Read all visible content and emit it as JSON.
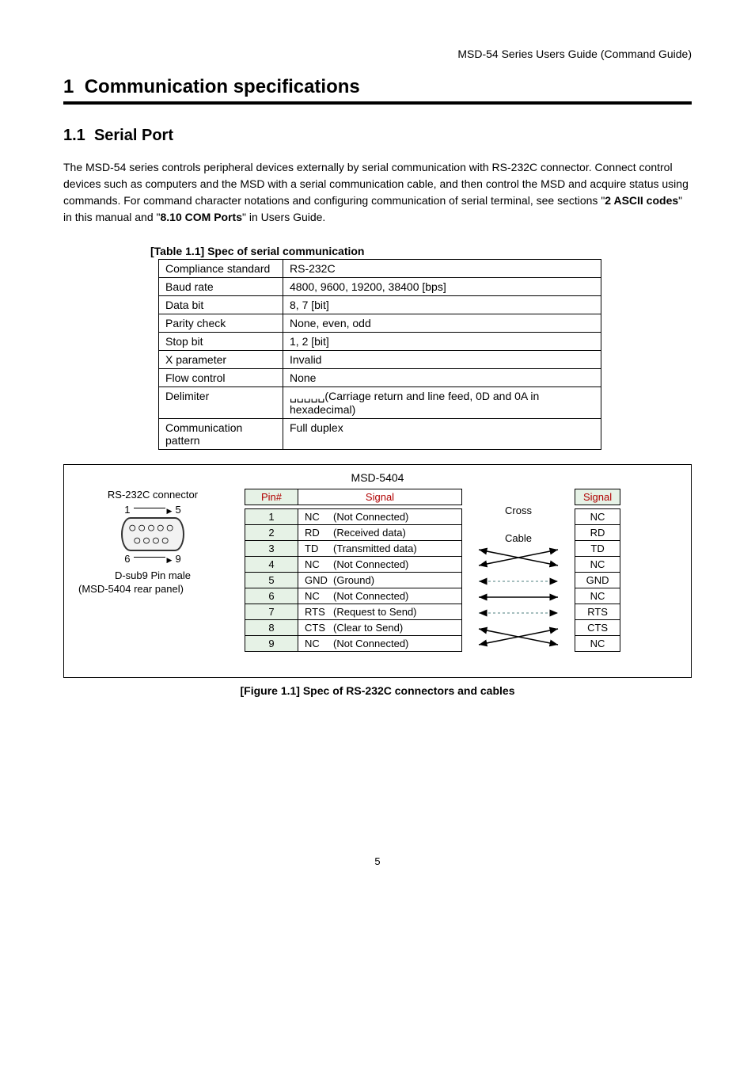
{
  "header": "MSD-54 Series Users Guide (Command Guide)",
  "h1_num": "1",
  "h1_title": "Communication specifications",
  "h2_num": "1.1",
  "h2_title": "Serial Port",
  "body_p1": "The MSD-54 series controls peripheral devices externally by serial communication with RS-232C connector. Connect control devices such as computers and the MSD with a serial communication cable, and then control the MSD and acquire status using commands. For command character notations and configuring communication of serial terminal, see sections \"",
  "body_b1": "2 ASCII codes",
  "body_p2": "\" in this manual and \"",
  "body_b2": "8.10 COM Ports",
  "body_p3": "\" in Users Guide.",
  "table_caption": "[Table 1.1] Spec of serial communication",
  "spec_rows": [
    {
      "k": "Compliance standard",
      "v": "RS-232C"
    },
    {
      "k": "Baud rate",
      "v": "4800, 9600, 19200, 38400 [bps]"
    },
    {
      "k": "Data bit",
      "v": "8, 7 [bit]"
    },
    {
      "k": "Parity check",
      "v": "None, even, odd"
    },
    {
      "k": "Stop bit",
      "v": "1, 2 [bit]"
    },
    {
      "k": "X parameter",
      "v": "Invalid"
    },
    {
      "k": "Flow control",
      "v": "None"
    },
    {
      "k": "Delimiter",
      "v": "␣␣␣␣␣(Carriage return and line feed, 0D and 0A in hexadecimal)"
    },
    {
      "k": "Communication pattern",
      "v": "Full duplex"
    }
  ],
  "figure_title": "MSD-5404",
  "left": {
    "connector_label": "RS-232C connector",
    "pin_top_from": "1",
    "pin_top_to": "5",
    "pin_bot_from": "6",
    "pin_bot_to": "9",
    "sub9": "D-sub9 Pin male",
    "rear_panel": "(MSD-5404 rear panel)"
  },
  "pin_header_pin": "Pin#",
  "pin_header_signal": "Signal",
  "pins": [
    {
      "n": "1",
      "abbr": "NC",
      "desc": "(Not Connected)"
    },
    {
      "n": "2",
      "abbr": "RD",
      "desc": "(Received data)"
    },
    {
      "n": "3",
      "abbr": "TD",
      "desc": "(Transmitted data)"
    },
    {
      "n": "4",
      "abbr": "NC",
      "desc": "(Not Connected)"
    },
    {
      "n": "5",
      "abbr": "GND",
      "desc": "(Ground)"
    },
    {
      "n": "6",
      "abbr": "NC",
      "desc": "(Not Connected)"
    },
    {
      "n": "7",
      "abbr": "RTS",
      "desc": "(Request to Send)"
    },
    {
      "n": "8",
      "abbr": "CTS",
      "desc": "(Clear to Send)"
    },
    {
      "n": "9",
      "abbr": "NC",
      "desc": "(Not Connected)"
    }
  ],
  "cross_label_1": "Cross",
  "cross_label_2": "Cable",
  "sig_right_header": "Signal",
  "sig_right": [
    "NC",
    "RD",
    "TD",
    "NC",
    "GND",
    "NC",
    "RTS",
    "CTS",
    "NC"
  ],
  "figure_caption": "[Figure 1.1] Spec of RS-232C connectors and cables",
  "page_num": "5"
}
